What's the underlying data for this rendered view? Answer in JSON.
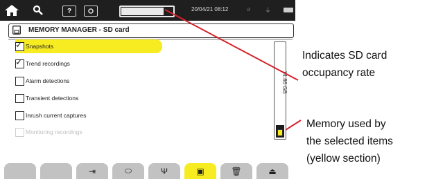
{
  "status_bar": {
    "home_icon": "home-icon",
    "tools_icon": "wrench-icon",
    "help_label": "?",
    "camera_icon": "camera-icon",
    "datetime": "20/04/21 08:12",
    "storage_fill_fraction": 0.8
  },
  "title": "MEMORY MANAGER - SD card",
  "items": [
    {
      "label": "Snapshots",
      "checked": true,
      "selected": true,
      "enabled": true
    },
    {
      "label": "Trend recordings",
      "checked": true,
      "selected": false,
      "enabled": true
    },
    {
      "label": "Alarm detections",
      "checked": false,
      "selected": false,
      "enabled": true
    },
    {
      "label": "Transient detections",
      "checked": false,
      "selected": false,
      "enabled": true
    },
    {
      "label": "Inrush current captures",
      "checked": false,
      "selected": false,
      "enabled": true
    },
    {
      "label": "Monitoring recordings",
      "checked": false,
      "selected": false,
      "enabled": false
    }
  ],
  "gauge": {
    "capacity_label": "14.86 GB",
    "used_fraction": 0.13,
    "selected_fraction": 0.06,
    "selected_color": "#f7ec22"
  },
  "toolbar": [
    {
      "icon": "",
      "active": false
    },
    {
      "icon": "",
      "active": false
    },
    {
      "icon": "export-icon",
      "glyph": "⇥",
      "active": false
    },
    {
      "icon": "loop-icon",
      "glyph": "⬭",
      "active": false
    },
    {
      "icon": "usb-icon",
      "glyph": "Ψ",
      "active": false
    },
    {
      "icon": "save-icon",
      "glyph": "▣",
      "active": true
    },
    {
      "icon": "trash-icon",
      "glyph": "🗑",
      "active": false
    },
    {
      "icon": "eject-icon",
      "glyph": "⏏",
      "active": false
    }
  ],
  "annotations": {
    "sd_card_title": "Indicates SD card",
    "sd_card_subtitle": "occupancy rate",
    "memory_line1": "Memory used by",
    "memory_line2": "the selected items",
    "memory_line3": "(yellow section)"
  },
  "colors": {
    "accent": "#f7ec22",
    "status_bar": "#1f1f1f",
    "callout_line": "#d6212c"
  }
}
